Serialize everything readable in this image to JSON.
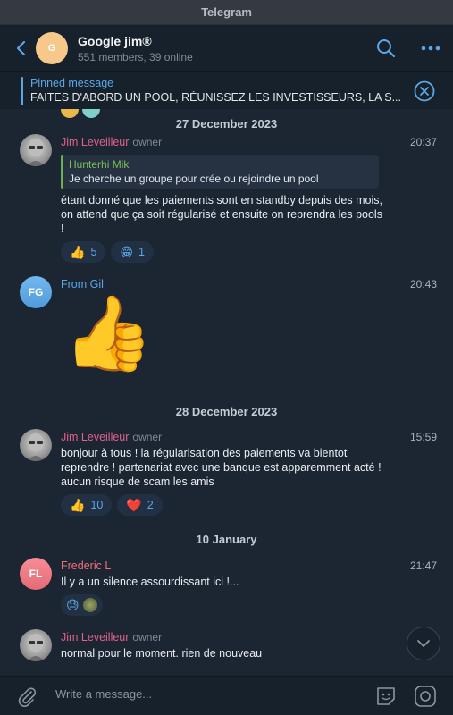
{
  "window": {
    "title": "Telegram"
  },
  "header": {
    "avatar_initial": "G",
    "group_name": "Google jim®",
    "subtitle": "551 members, 39 online"
  },
  "pinned": {
    "label": "Pinned message",
    "text": "FAITES D'ABORD UN POOL, RÉUNISSEZ LES INVESTISSEURS, LA S..."
  },
  "dates": {
    "d1": "27 December 2023",
    "d2": "28 December 2023",
    "d3": "10 January"
  },
  "messages": [
    {
      "sender": "Jim Leveilleur",
      "role": "owner",
      "time": "20:37",
      "reply_name": "Hunterhi Mik",
      "reply_text": "Je cherche un groupe pour crée ou rejoindre un pool",
      "text": "étant donné que les paiements sont en standby depuis des mois, on attend que ça soit régularisé et ensuite on reprendra les pools !",
      "reactions": [
        {
          "emoji": "👍",
          "count": "5"
        },
        {
          "emoji": "😁",
          "count": "1"
        }
      ]
    },
    {
      "sender": "From Gil",
      "avatar_initials": "FG",
      "time": "20:43",
      "sticker": "👍"
    },
    {
      "sender": "Jim Leveilleur",
      "role": "owner",
      "time": "15:59",
      "text": "bonjour à tous ! la régularisation des paiements va bientot reprendre ! partenariat avec une banque est apparemment acté ! aucun risque de scam les amis",
      "reactions": [
        {
          "emoji": "👍",
          "count": "10"
        },
        {
          "emoji": "❤️",
          "count": "2"
        }
      ]
    },
    {
      "sender": "Frederic L",
      "avatar_initials": "FL",
      "time": "21:47",
      "text": "Il y a un silence assourdissant ici !...",
      "reactions": [
        {
          "emoji": "😓",
          "count": ""
        }
      ]
    },
    {
      "sender": "Jim Leveilleur",
      "role": "owner",
      "text": "normal pour le moment. rien de nouveau"
    }
  ],
  "composer": {
    "placeholder": "Write a message..."
  },
  "colors": {
    "accent": "#5aa7e8",
    "owner_name": "#e0608e",
    "from_gil_name": "#5aa7e8",
    "frederic_name": "#f0707a",
    "reply_green": "#78c057"
  }
}
